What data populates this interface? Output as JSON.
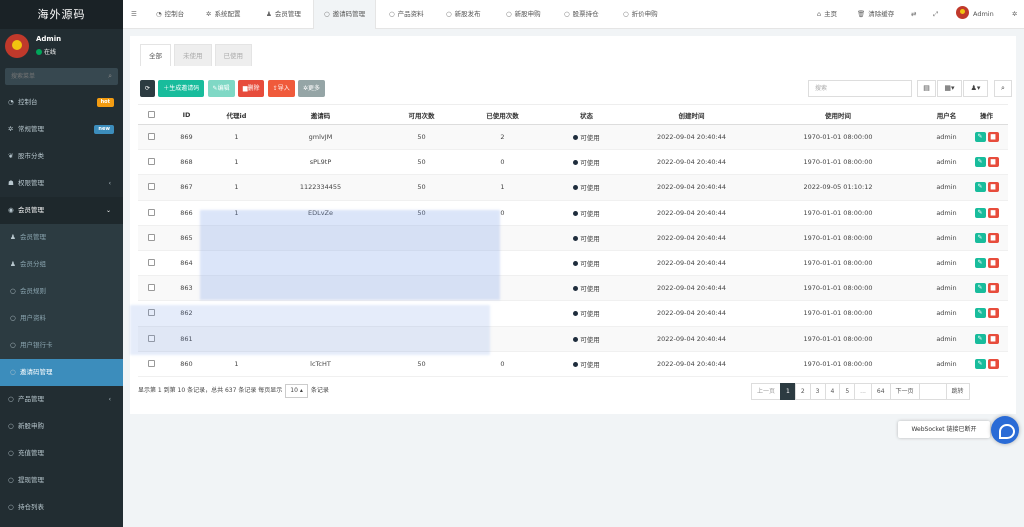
{
  "sidebar": {
    "brand": "海外源码",
    "user_name": "Admin",
    "user_status": "在线",
    "search_placeholder": "搜索菜单",
    "items": [
      {
        "label": "控制台",
        "badge": "hot",
        "badge_color": "#3c8dbc"
      },
      {
        "label": "常规管理",
        "badge": "new",
        "badge_color": "#3c8dbc"
      },
      {
        "label": "股市分类"
      },
      {
        "label": "权限管理"
      },
      {
        "label": "会员管理"
      },
      {
        "label": "会员管理"
      },
      {
        "label": "会员分组"
      },
      {
        "label": "会员规则"
      },
      {
        "label": "用户资料"
      },
      {
        "label": "用户银行卡"
      },
      {
        "label": "邀请码管理"
      },
      {
        "label": "产品管理"
      },
      {
        "label": "新股申购"
      },
      {
        "label": "充值管理"
      },
      {
        "label": "提现管理"
      },
      {
        "label": "持仓列表"
      }
    ]
  },
  "topbar": {
    "tabs": [
      "控制台",
      "系统配置",
      "会员管理",
      "邀请码管理",
      "产品资料",
      "新股发布",
      "新股申购",
      "股票持仓",
      "折价申购"
    ],
    "home": "主页",
    "clear_cache": "清除缓存",
    "user": "Admin"
  },
  "panel": {
    "tabs": [
      "全部",
      "未使用",
      "已使用"
    ],
    "buttons": {
      "refresh": "",
      "generate": "生成邀请码",
      "edit": "编辑",
      "delete": "删除",
      "import": "导入",
      "more": "更多"
    },
    "search_placeholder": "搜索"
  },
  "table": {
    "headers": [
      "",
      "ID",
      "代理id",
      "邀请码",
      "可用次数",
      "已使用次数",
      "状态",
      "创建时间",
      "使用时间",
      "用户名",
      "操作"
    ],
    "rows": [
      [
        "869",
        "1",
        "gmlvJM",
        "50",
        "2",
        "可使用",
        "2022-09-04 20:40:44",
        "1970-01-01 08:00:00",
        "admin"
      ],
      [
        "868",
        "1",
        "sPL9tP",
        "50",
        "0",
        "可使用",
        "2022-09-04 20:40:44",
        "1970-01-01 08:00:00",
        "admin"
      ],
      [
        "867",
        "1",
        "1122334455",
        "50",
        "1",
        "可使用",
        "2022-09-04 20:40:44",
        "2022-09-05 01:10:12",
        "admin"
      ],
      [
        "866",
        "1",
        "EDLvZe",
        "50",
        "0",
        "可使用",
        "2022-09-04 20:40:44",
        "1970-01-01 08:00:00",
        "admin"
      ],
      [
        "865",
        "",
        "",
        "",
        "",
        "可使用",
        "2022-09-04 20:40:44",
        "1970-01-01 08:00:00",
        "admin"
      ],
      [
        "864",
        "",
        "",
        "",
        "",
        "可使用",
        "2022-09-04 20:40:44",
        "1970-01-01 08:00:00",
        "admin"
      ],
      [
        "863",
        "",
        "",
        "",
        "",
        "可使用",
        "2022-09-04 20:40:44",
        "1970-01-01 08:00:00",
        "admin"
      ],
      [
        "862",
        "",
        "",
        "",
        "",
        "可使用",
        "2022-09-04 20:40:44",
        "1970-01-01 08:00:00",
        "admin"
      ],
      [
        "861",
        "",
        "",
        "",
        "",
        "可使用",
        "2022-09-04 20:40:44",
        "1970-01-01 08:00:00",
        "admin"
      ],
      [
        "860",
        "1",
        "lcTcHT",
        "50",
        "0",
        "可使用",
        "2022-09-04 20:40:44",
        "1970-01-01 08:00:00",
        "admin"
      ]
    ]
  },
  "pagination": {
    "info_prefix": "显示第 1 到第 10 条记录，总共 637 条记录 每页显示",
    "page_size": "10",
    "info_suffix": "条记录",
    "prev": "上一页",
    "pages": [
      "1",
      "2",
      "3",
      "4",
      "5",
      "...",
      "64"
    ],
    "next": "下一页",
    "jump": "跳转"
  },
  "websocket_tip": "WebSocket 链接已断开"
}
